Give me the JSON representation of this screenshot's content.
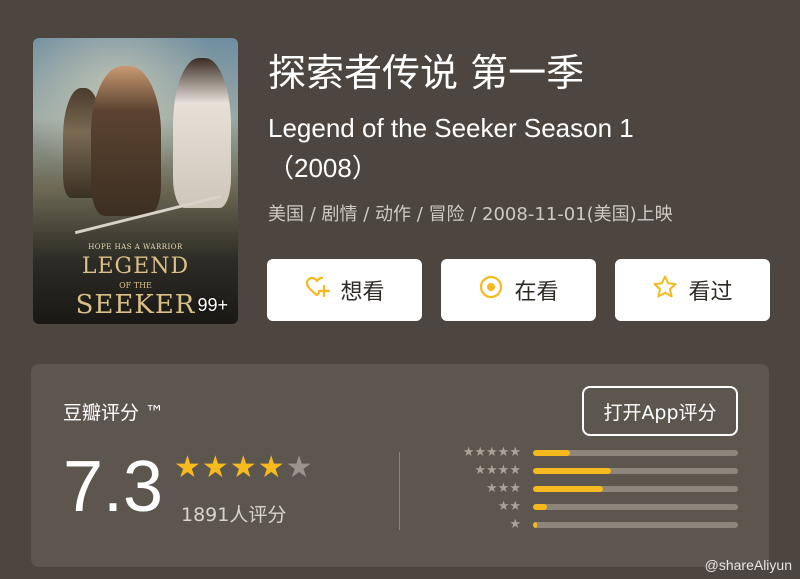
{
  "movie": {
    "title_cn": "探索者传说 第一季",
    "title_en": "Legend of the Seeker Season 1 （2008）",
    "meta": "美国 / 剧情 / 动作 / 冒险 / 2008-11-01(美国)上映",
    "poster": {
      "tagline": "HOPE HAS A WARRIOR",
      "logo_line1": "LEGEND",
      "logo_line2": "OF THE",
      "logo_line3": "SEEKER",
      "badge": "99+"
    }
  },
  "actions": {
    "want": {
      "label": "想看",
      "icon": "heart-plus-icon"
    },
    "watching": {
      "label": "在看",
      "icon": "target-circle-icon"
    },
    "watched": {
      "label": "看过",
      "icon": "star-outline-icon"
    }
  },
  "rating": {
    "title": "豆瓣评分 ™",
    "open_app_label": "打开App评分",
    "score": "7.3",
    "stars_filled": 4,
    "stars_total": 5,
    "count_label": "1891人评分",
    "distribution": [
      {
        "stars": 5,
        "fraction": 0.18
      },
      {
        "stars": 4,
        "fraction": 0.38
      },
      {
        "stars": 3,
        "fraction": 0.34
      },
      {
        "stars": 2,
        "fraction": 0.07
      },
      {
        "stars": 1,
        "fraction": 0.02
      }
    ]
  },
  "colors": {
    "accent": "#f6b91e",
    "background": "#4d4640",
    "panel": "#5d564e"
  },
  "watermark": "@shareAliyun"
}
